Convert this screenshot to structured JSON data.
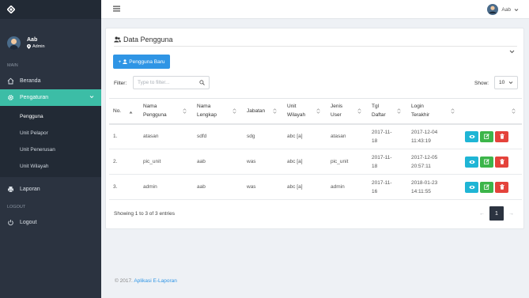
{
  "sidebar": {
    "user": {
      "name": "Aab",
      "role": "Admin"
    },
    "main_label": "MAIN",
    "items": {
      "beranda": "Beranda",
      "pengaturan": "Pengaturan",
      "laporan": "Laporan"
    },
    "submenu": [
      "Pengguna",
      "Unit Pelapor",
      "Unit Penerusan",
      "Unit Wilayah"
    ],
    "logout_label": "LOGOUT",
    "logout": "Logout"
  },
  "topbar": {
    "user_name": "Aab"
  },
  "panel": {
    "title": "Data Pengguna",
    "add_button": "Pengguna Baru",
    "filter_label": "Filter:",
    "filter_placeholder": "Type to filter...",
    "show_label": "Show:",
    "show_value": "10"
  },
  "table": {
    "headers": {
      "no": "No.",
      "nama_pengguna": [
        "Nama",
        "Pengguna"
      ],
      "nama_lengkap": [
        "Nama",
        "Lengkap"
      ],
      "jabatan": "Jabatan",
      "unit_wilayah": [
        "Unit",
        "Wilayah"
      ],
      "jenis_user": [
        "Jenis",
        "User"
      ],
      "tgl_daftar": [
        "Tgl",
        "Daftar"
      ],
      "login_terakhir": [
        "Login",
        "Terakhir"
      ]
    },
    "rows": [
      {
        "no": "1.",
        "nama_pengguna": "atasan",
        "nama_lengkap": "sdfd",
        "jabatan": "sdg",
        "unit_wilayah": "abc [a]",
        "jenis_user": "atasan",
        "tgl_daftar": [
          "2017-11-",
          "18"
        ],
        "login_terakhir": [
          "2017-12-04",
          "11:43:19"
        ]
      },
      {
        "no": "2.",
        "nama_pengguna": "pic_unit",
        "nama_lengkap": "aab",
        "jabatan": "was",
        "unit_wilayah": "abc [a]",
        "jenis_user": "pic_unit",
        "tgl_daftar": [
          "2017-11-",
          "18"
        ],
        "login_terakhir": [
          "2017-12-05",
          "20:57:11"
        ]
      },
      {
        "no": "3.",
        "nama_pengguna": "admin",
        "nama_lengkap": "aab",
        "jabatan": "was",
        "unit_wilayah": "abc [a]",
        "jenis_user": "admin",
        "tgl_daftar": [
          "2017-11-",
          "16"
        ],
        "login_terakhir": [
          "2018-01-23",
          "14:11:55"
        ]
      }
    ],
    "showing": "Showing 1 to 3 of 3 entries",
    "pagination": {
      "prev": "←",
      "current": "1",
      "next": "→"
    }
  },
  "footer": {
    "prefix": "© 2017.",
    "link": "Aplikasi E-Laporan"
  },
  "colors": {
    "sidebar": "#2b3340",
    "accent": "#3cbda6",
    "primary": "#2f95e5",
    "info": "#1fb5d5",
    "success": "#3cb54a",
    "danger": "#e4433b"
  }
}
